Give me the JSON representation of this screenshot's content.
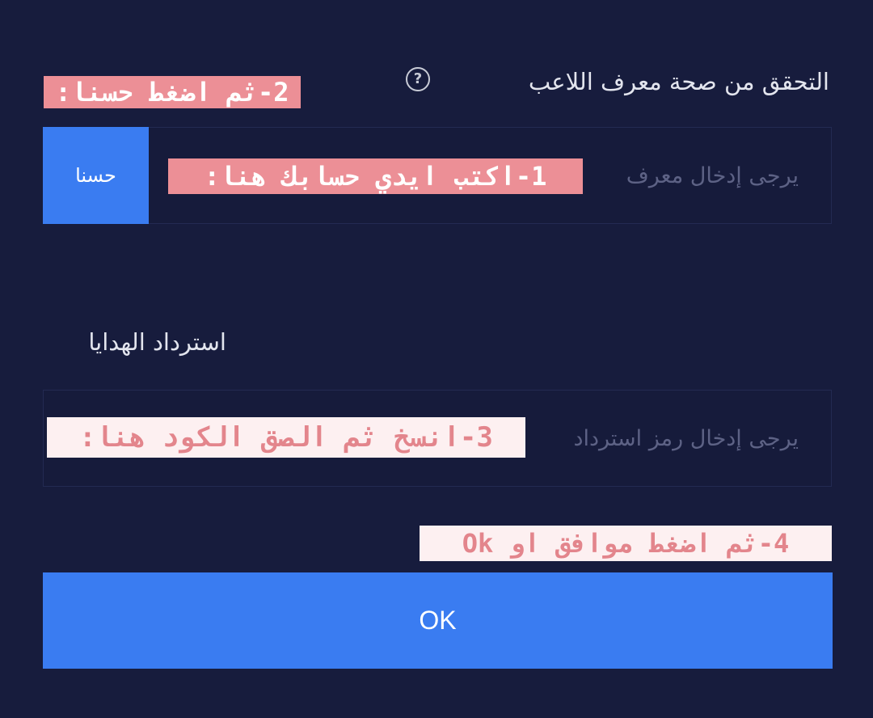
{
  "verify": {
    "title": "التحقق من صحة معرف اللاعب",
    "help_glyph": "?",
    "id_placeholder": "يرجى إدخال معرف",
    "ok_label": "حسنا"
  },
  "redeem": {
    "title": "استرداد الهدايا",
    "code_placeholder": "يرجى إدخال رمز استرداد",
    "submit_label": "OK"
  },
  "annotations": {
    "step1": "1-اكتب ايدي حسابك هنا:",
    "step2": "2-ثم اضغط حسنا:",
    "step3": "3-انسخ ثم الصق الكود هنا:",
    "step4": "4-ثم اضغط موافق او Ok"
  },
  "colors": {
    "background": "#171c3d",
    "input_background": "#161b3b",
    "accent_blue": "#3a7cf1",
    "annotation_pink": "#ec8f96",
    "annotation_light": "#fdf0f1"
  },
  "icons": {
    "help": "question-circle-icon"
  }
}
